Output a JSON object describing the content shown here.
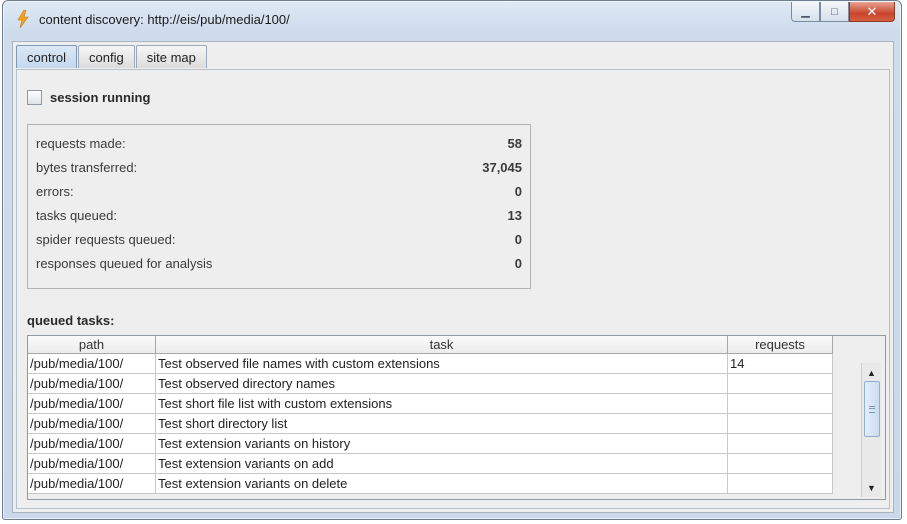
{
  "window": {
    "title": "content discovery: http://eis/pub/media/100/",
    "controls": {
      "minimize": "▁",
      "maximize": "□",
      "close": "✕"
    },
    "app_icon": "lightning-bolt-icon",
    "accent": "#f4a21a"
  },
  "tabs": [
    {
      "label": "control",
      "active": true
    },
    {
      "label": "config",
      "active": false
    },
    {
      "label": "site map",
      "active": false
    }
  ],
  "control": {
    "session_running_label": "session running",
    "session_running_checked": false,
    "stats": [
      {
        "label": "requests made:",
        "value": "58"
      },
      {
        "label": "bytes transferred:",
        "value": "37,045"
      },
      {
        "label": "errors:",
        "value": "0"
      },
      {
        "label": "tasks queued:",
        "value": "13"
      },
      {
        "label": "spider requests queued:",
        "value": "0"
      },
      {
        "label": "responses queued for analysis",
        "value": "0"
      }
    ],
    "queued_tasks_label": "queued tasks:",
    "table": {
      "columns": [
        "path",
        "task",
        "requests"
      ],
      "rows": [
        {
          "path": "/pub/media/100/",
          "task": "Test observed file names with custom extensions",
          "requests": "14"
        },
        {
          "path": "/pub/media/100/",
          "task": "Test observed directory names",
          "requests": ""
        },
        {
          "path": "/pub/media/100/",
          "task": "Test short file list with custom extensions",
          "requests": ""
        },
        {
          "path": "/pub/media/100/",
          "task": "Test short directory list",
          "requests": ""
        },
        {
          "path": "/pub/media/100/",
          "task": "Test extension variants on history",
          "requests": ""
        },
        {
          "path": "/pub/media/100/",
          "task": "Test extension variants on add",
          "requests": ""
        },
        {
          "path": "/pub/media/100/",
          "task": "Test extension variants on delete",
          "requests": ""
        }
      ]
    },
    "scrollbar": {
      "up": "▲",
      "down": "▼"
    }
  }
}
